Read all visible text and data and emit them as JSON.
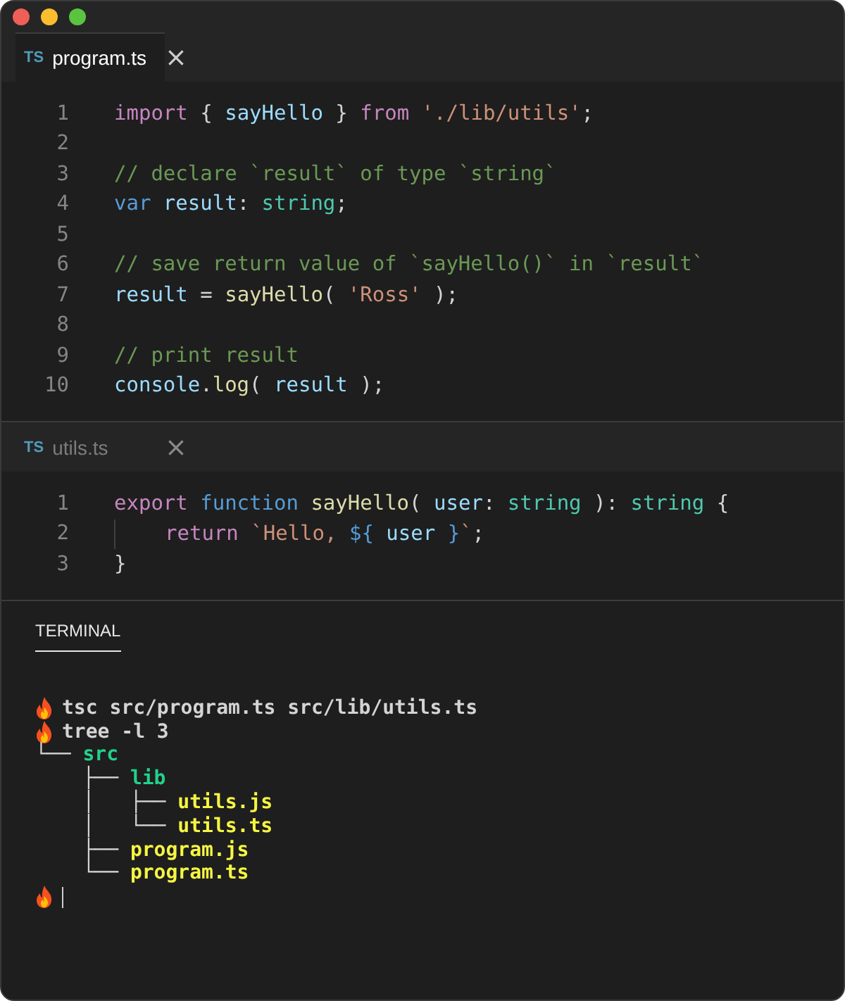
{
  "editors": [
    {
      "tab": {
        "type_label": "TS",
        "name": "program.ts",
        "close": "×",
        "selected": true
      },
      "lines": [
        {
          "number": "1",
          "tokens": [
            {
              "t": "import",
              "kind": "keyword"
            },
            {
              "t": " { ",
              "kind": "plain"
            },
            {
              "t": "sayHello",
              "kind": "variable"
            },
            {
              "t": " } ",
              "kind": "plain"
            },
            {
              "t": "from",
              "kind": "keyword"
            },
            {
              "t": " './lib/utils'",
              "kind": "string"
            },
            {
              "t": ";",
              "kind": "plain"
            }
          ]
        },
        {
          "number": "2"
        },
        {
          "number": "3",
          "tokens": [
            {
              "t": "// declare `result` of type `string`",
              "kind": "comment"
            }
          ]
        },
        {
          "number": "4",
          "tokens": [
            {
              "t": "var",
              "kind": "storage"
            },
            {
              "t": " result",
              "kind": "variable"
            },
            {
              "t": ": ",
              "kind": "plain"
            },
            {
              "t": "string",
              "kind": "type"
            },
            {
              "t": ";",
              "kind": "plain"
            }
          ]
        },
        {
          "number": "5"
        },
        {
          "number": "6",
          "tokens": [
            {
              "t": "// save return value of `sayHello()` in `result`",
              "kind": "comment"
            }
          ]
        },
        {
          "number": "7",
          "tokens": [
            {
              "t": "result",
              "kind": "variable"
            },
            {
              "t": " = ",
              "kind": "plain"
            },
            {
              "t": "sayHello",
              "kind": "function"
            },
            {
              "t": "( ",
              "kind": "plain"
            },
            {
              "t": "'Ross'",
              "kind": "string"
            },
            {
              "t": " );",
              "kind": "plain"
            }
          ]
        },
        {
          "number": "8"
        },
        {
          "number": "9",
          "tokens": [
            {
              "t": "// print result",
              "kind": "comment"
            }
          ]
        },
        {
          "number": "10",
          "tokens": [
            {
              "t": "console",
              "kind": "variable"
            },
            {
              "t": ".",
              "kind": "plain"
            },
            {
              "t": "log",
              "kind": "function"
            },
            {
              "t": "( ",
              "kind": "plain"
            },
            {
              "t": "result",
              "kind": "variable"
            },
            {
              "t": " );",
              "kind": "plain"
            }
          ]
        }
      ]
    },
    {
      "tab": {
        "type_label": "TS",
        "name": "utils.ts",
        "close": "×",
        "selected": false
      },
      "lines": [
        {
          "number": "1",
          "tokens": [
            {
              "t": "export",
              "kind": "keyword"
            },
            {
              "t": " function",
              "kind": "storage"
            },
            {
              "t": " sayHello",
              "kind": "function"
            },
            {
              "t": "( ",
              "kind": "plain"
            },
            {
              "t": "user",
              "kind": "variable"
            },
            {
              "t": ": ",
              "kind": "plain"
            },
            {
              "t": "string",
              "kind": "type"
            },
            {
              "t": " ): ",
              "kind": "plain"
            },
            {
              "t": "string",
              "kind": "type"
            },
            {
              "t": " {",
              "kind": "plain"
            }
          ]
        },
        {
          "number": "2",
          "indented": true,
          "tokens": [
            {
              "t": "return",
              "kind": "keyword"
            },
            {
              "t": " `Hello, ",
              "kind": "string"
            },
            {
              "t": "${",
              "kind": "storage"
            },
            {
              "t": " user ",
              "kind": "variable"
            },
            {
              "t": "}",
              "kind": "storage"
            },
            {
              "t": "`",
              "kind": "string"
            },
            {
              "t": ";",
              "kind": "plain"
            }
          ]
        },
        {
          "number": "3",
          "tokens": [
            {
              "t": "}",
              "kind": "plain"
            }
          ]
        }
      ]
    }
  ],
  "terminal": {
    "tab": {
      "label": "TERMINAL",
      "selected": true
    },
    "lines": [
      {
        "prompt": true,
        "segments": [
          {
            "t": "tsc src/program.ts src/lib/utils.ts",
            "kind": "plain"
          }
        ]
      },
      {
        "prompt": true,
        "segments": [
          {
            "t": "tree -l 3",
            "kind": "plain"
          }
        ]
      },
      {
        "prompt": false,
        "segments": [
          {
            "t": "└── ",
            "kind": "plain"
          },
          {
            "t": "src",
            "kind": "dir"
          }
        ]
      },
      {
        "prompt": false,
        "segments": [
          {
            "t": "    ├── ",
            "kind": "plain"
          },
          {
            "t": "lib",
            "kind": "dir"
          }
        ]
      },
      {
        "prompt": false,
        "segments": [
          {
            "t": "    │   ├── ",
            "kind": "plain"
          },
          {
            "t": "utils.js",
            "kind": "file"
          }
        ]
      },
      {
        "prompt": false,
        "segments": [
          {
            "t": "    │   └── ",
            "kind": "plain"
          },
          {
            "t": "utils.ts",
            "kind": "file"
          }
        ]
      },
      {
        "prompt": false,
        "segments": [
          {
            "t": "    ├── ",
            "kind": "plain"
          },
          {
            "t": "program.js",
            "kind": "file"
          }
        ]
      },
      {
        "prompt": false,
        "segments": [
          {
            "t": "    └── ",
            "kind": "plain"
          },
          {
            "t": "program.ts",
            "kind": "file"
          }
        ]
      },
      {
        "prompt": true,
        "cursor": true
      }
    ]
  }
}
